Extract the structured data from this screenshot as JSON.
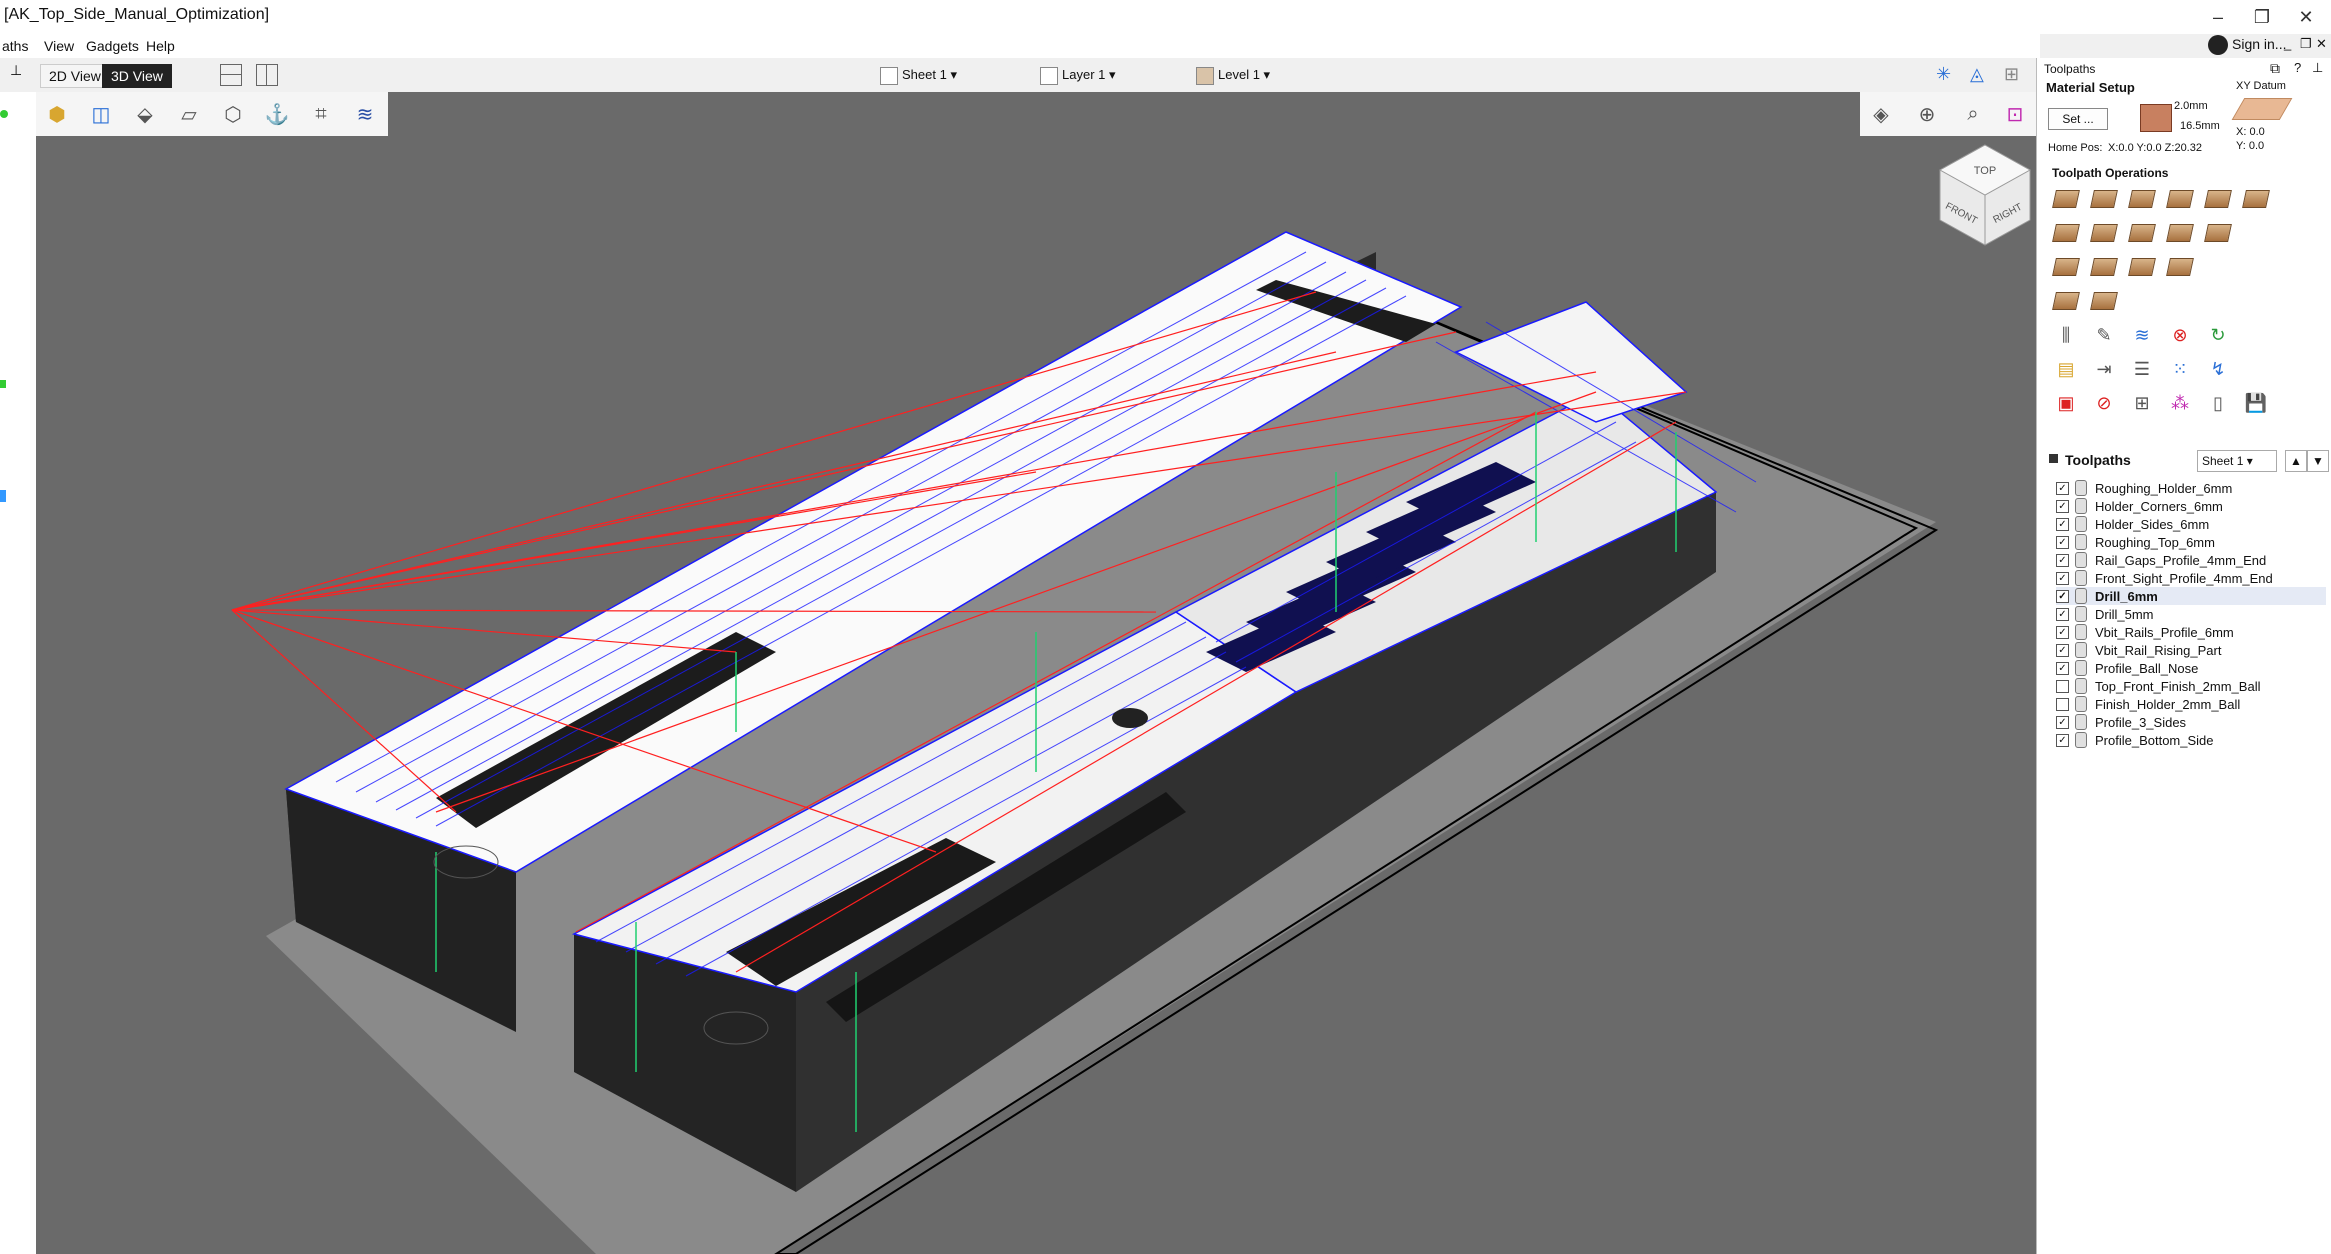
{
  "window": {
    "title": "[AK_Top_Side_Manual_Optimization]",
    "controls": [
      "–",
      "❐",
      "✕"
    ]
  },
  "menu": {
    "items": [
      "aths",
      "View",
      "Gadgets",
      "Help"
    ]
  },
  "account": {
    "sign_in": "Sign in...",
    "panel_controls": [
      "_",
      "❐",
      "✕"
    ]
  },
  "view_toolbar": {
    "view_2d": "2D View",
    "view_3d": "3D View",
    "sheet": "Sheet 1",
    "layer": "Layer 1",
    "level": "Level 1"
  },
  "viewcube": {
    "top": "TOP",
    "front": "FRONT",
    "right": "RIGHT"
  },
  "panel": {
    "title": "Toolpaths",
    "material_setup": "Material Setup",
    "set_button": "Set ...",
    "thickness_top": "2.0mm",
    "thickness_total": "16.5mm",
    "xy_datum": "XY Datum",
    "datum_x": "X: 0.0",
    "datum_y": "Y: 0.0",
    "home_pos_label": "Home Pos:",
    "home_pos_value": "X:0.0 Y:0.0 Z:20.32",
    "operations_title": "Toolpath Operations",
    "list_title": "Toolpaths",
    "sheet_select": "Sheet 1"
  },
  "toolpaths": [
    {
      "name": "Roughing_Holder_6mm",
      "checked": true
    },
    {
      "name": "Holder_Corners_6mm",
      "checked": true
    },
    {
      "name": "Holder_Sides_6mm",
      "checked": true
    },
    {
      "name": "Roughing_Top_6mm",
      "checked": true
    },
    {
      "name": "Rail_Gaps_Profile_4mm_End",
      "checked": true
    },
    {
      "name": "Front_Sight_Profile_4mm_End",
      "checked": true
    },
    {
      "name": "Drill_6mm",
      "checked": true,
      "selected": true
    },
    {
      "name": "Drill_5mm",
      "checked": true
    },
    {
      "name": "Vbit_Rails_Profile_6mm",
      "checked": true
    },
    {
      "name": "Vbit_Rail_Rising_Part",
      "checked": true
    },
    {
      "name": "Profile_Ball_Nose",
      "checked": true
    },
    {
      "name": "Top_Front_Finish_2mm_Ball",
      "checked": false
    },
    {
      "name": "Finish_Holder_2mm_Ball",
      "checked": false
    },
    {
      "name": "Profile_3_Sides",
      "checked": true
    },
    {
      "name": "Profile_Bottom_Side",
      "checked": true
    }
  ],
  "colors": {
    "viewport": "#6a6a6a",
    "toolpath_blue": "#1a1aff",
    "rapid_red": "#ff2020",
    "plunge_green": "#20d070",
    "material_top": "#ffffff",
    "material_side": "#2a2a2a"
  }
}
